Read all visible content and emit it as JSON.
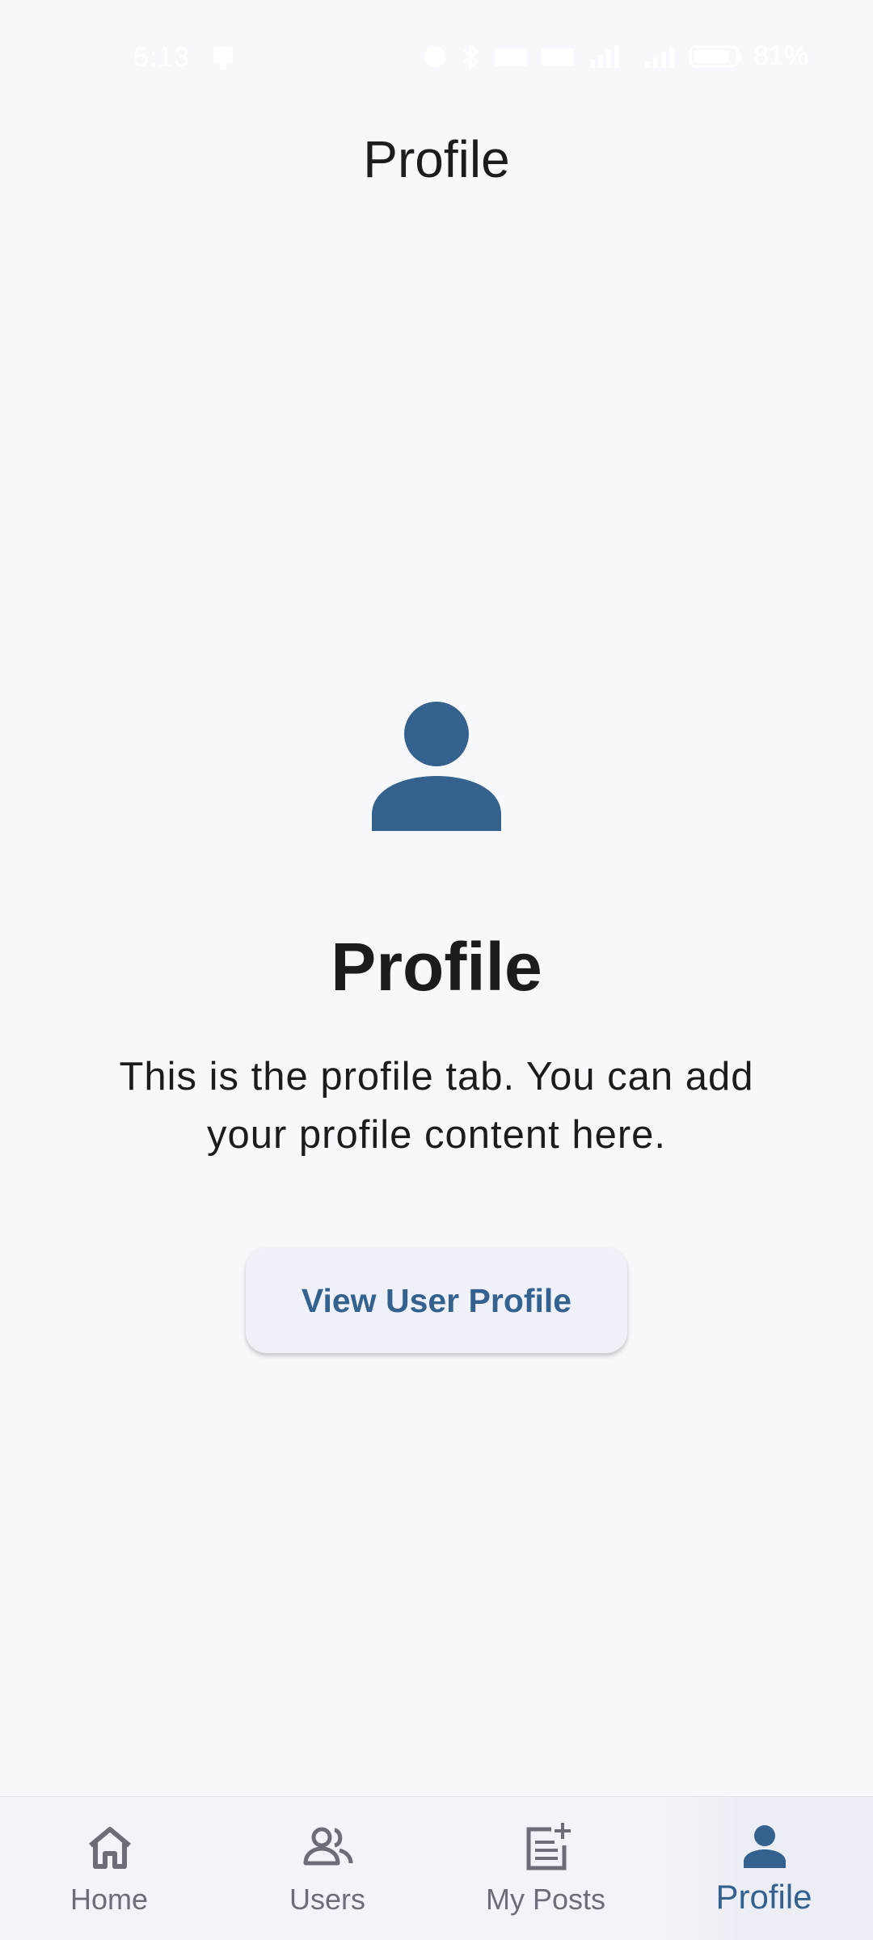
{
  "status_bar": {
    "time": "5:13",
    "battery": "81%"
  },
  "app_bar": {
    "title": "Profile"
  },
  "content": {
    "heading": "Profile",
    "description": "This is the profile tab. You can add your profile content here.",
    "button_label": "View User Profile"
  },
  "bottom_nav": {
    "items": [
      {
        "label": "Home",
        "icon": "home-icon",
        "active": false
      },
      {
        "label": "Users",
        "icon": "users-icon",
        "active": false
      },
      {
        "label": "My Posts",
        "icon": "post-add-icon",
        "active": false
      },
      {
        "label": "Profile",
        "icon": "person-icon",
        "active": true
      }
    ]
  },
  "colors": {
    "accent": "#34618e",
    "background": "#f7f8fc",
    "inactive": "#6b6e76"
  }
}
